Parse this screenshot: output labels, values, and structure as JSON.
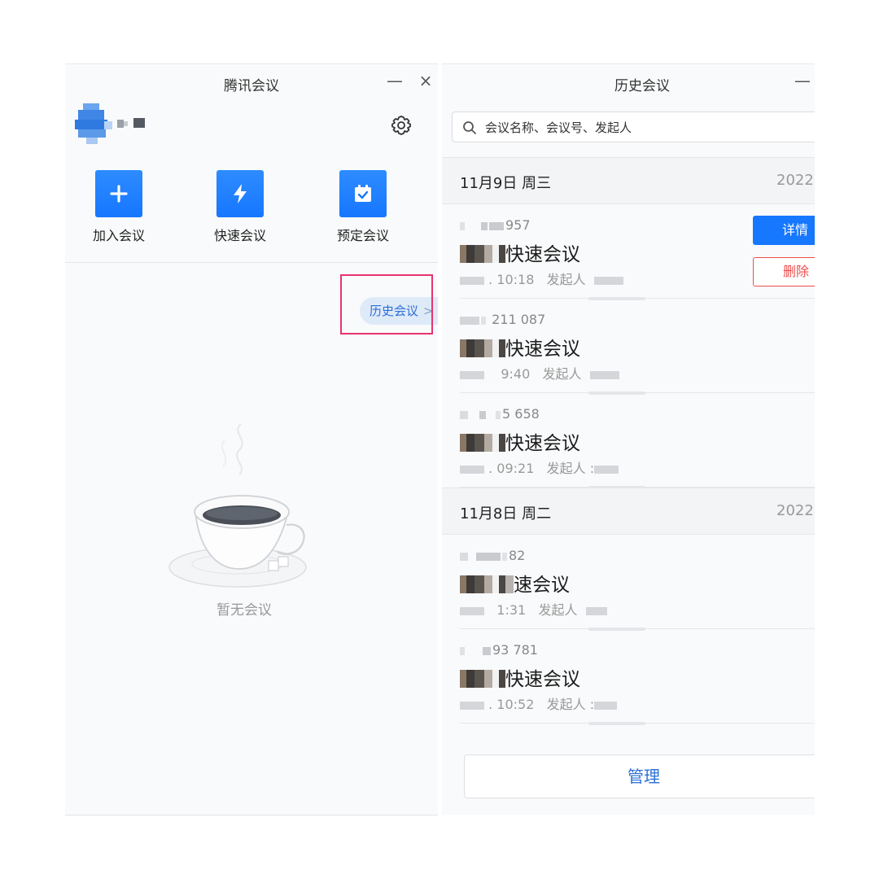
{
  "left_window": {
    "title": "腾讯会议",
    "minimize_glyph": "—",
    "close_glyph": "×",
    "actions": [
      {
        "label": "加入会议",
        "icon": "plus-icon"
      },
      {
        "label": "快速会议",
        "icon": "lightning-icon"
      },
      {
        "label": "预定会议",
        "icon": "calendar-icon"
      }
    ],
    "history_button": {
      "label": "历史会议",
      "chevron": ">"
    },
    "empty_state": "暂无会议",
    "colors": {
      "accent": "#1677ff",
      "highlight_box": "#e8336d",
      "history_button_bg": "#dfeaf9"
    }
  },
  "right_window": {
    "title": "历史会议",
    "minimize_glyph": "—",
    "search": {
      "placeholder": "会议名称、会议号、发起人",
      "icon": "search-icon"
    },
    "groups": [
      {
        "date": "11月9日 周三",
        "year": "2022",
        "meetings": [
          {
            "number": "957",
            "title": "快速会议",
            "time": ". 10:18",
            "initiator_label": "发起人"
          },
          {
            "number": "211 087",
            "title": "快速会议",
            "time": "9:40",
            "initiator_label": "发起人"
          },
          {
            "number": "5 658",
            "title": "快速会议",
            "time": ". 09:21",
            "initiator_label": "发起人 :"
          }
        ]
      },
      {
        "date": "11月8日 周二",
        "year": "2022",
        "meetings": [
          {
            "number": "82",
            "title": "速会议",
            "time": "1:31",
            "initiator_label": "发起人"
          },
          {
            "number": "93 781",
            "title": "快速会议",
            "time": ". 10:52",
            "initiator_label": "发起人 :"
          }
        ]
      }
    ],
    "row_buttons": {
      "detail": "详情",
      "delete": "删除"
    },
    "manage_label": "管理",
    "colors": {
      "detail_bg": "#1677ff",
      "delete_border": "#f04c4c"
    }
  }
}
